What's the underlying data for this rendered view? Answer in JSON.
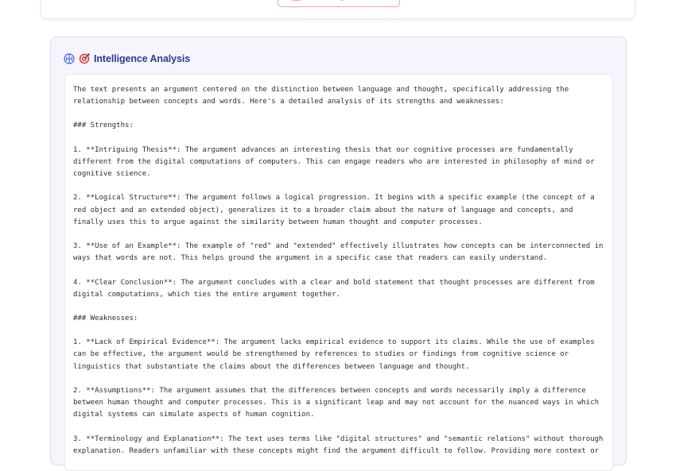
{
  "analysis": {
    "title": "Intelligence Analysis",
    "icons": [
      "brain-icon",
      "target-icon"
    ],
    "title_color": "#2b3a8f",
    "text": "The text presents an argument centered on the distinction between language and thought, specifically addressing the relationship between concepts and words. Here's a detailed analysis of its strengths and weaknesses:\n\n### Strengths:\n\n1. **Intriguing Thesis**: The argument advances an interesting thesis that our cognitive processes are fundamentally different from the digital computations of computers. This can engage readers who are interested in philosophy of mind or cognitive science.\n\n2. **Logical Structure**: The argument follows a logical progression. It begins with a specific example (the concept of a red object and an extended object), generalizes it to a broader claim about the nature of language and concepts, and finally uses this to argue against the similarity between human thought and computer processes.\n\n3. **Use of an Example**: The example of \"red\" and \"extended\" effectively illustrates how concepts can be interconnected in ways that words are not. This helps ground the argument in a specific case that readers can easily understand.\n\n4. **Clear Conclusion**: The argument concludes with a clear and bold statement that thought processes are different from digital computations, which ties the entire argument together.\n\n### Weaknesses:\n\n1. **Lack of Empirical Evidence**: The argument lacks empirical evidence to support its claims. While the use of examples can be effective, the argument would be strengthened by references to studies or findings from cognitive science or linguistics that substantiate the claims about the differences between language and thought.\n\n2. **Assumptions**: The argument assumes that the differences between concepts and words necessarily imply a difference between human thought and computer processes. This is a significant leap and may not account for the nuanced ways in which digital systems can simulate aspects of human cognition.\n\n3. **Terminology and Explanation**: The text uses terms like \"digital structures\" and \"semantic relations\" without thorough explanation. Readers unfamiliar with these concepts might find the argument difficult to follow. Providing more context or"
  }
}
